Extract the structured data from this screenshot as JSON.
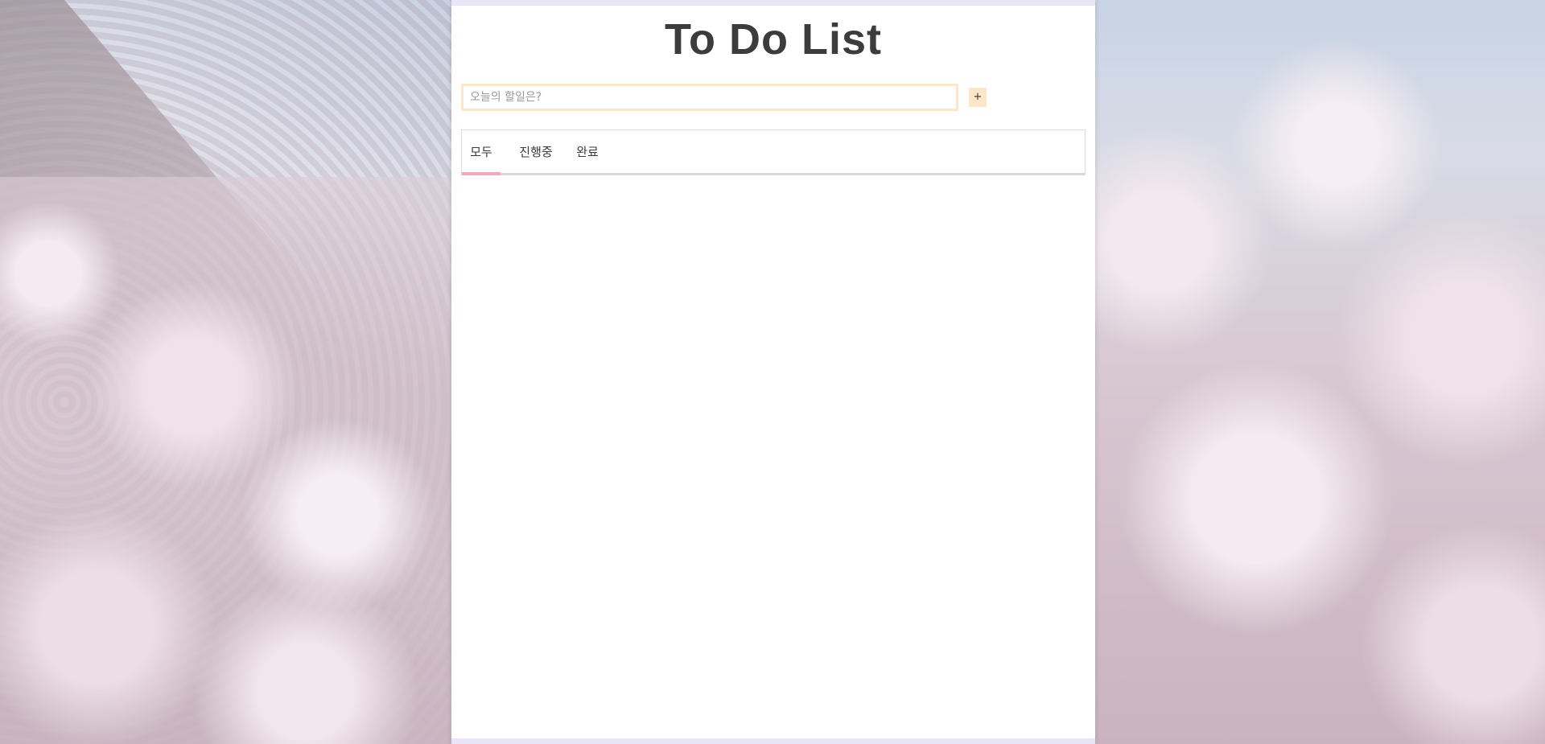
{
  "header": {
    "title": "To Do List"
  },
  "input": {
    "placeholder": "오늘의 할일은?",
    "value": "",
    "add_label": "+"
  },
  "tabs": [
    {
      "label": "모두",
      "selected": true
    },
    {
      "label": "진행중",
      "selected": false
    },
    {
      "label": "완료",
      "selected": false
    }
  ],
  "colors": {
    "border_accent": "#e9e4f7",
    "input_border": "#fde7c8",
    "add_button_bg": "#fde7c8",
    "tab_underline": "#f2a8b8",
    "title_text": "#3c3c3c"
  },
  "tasks": []
}
